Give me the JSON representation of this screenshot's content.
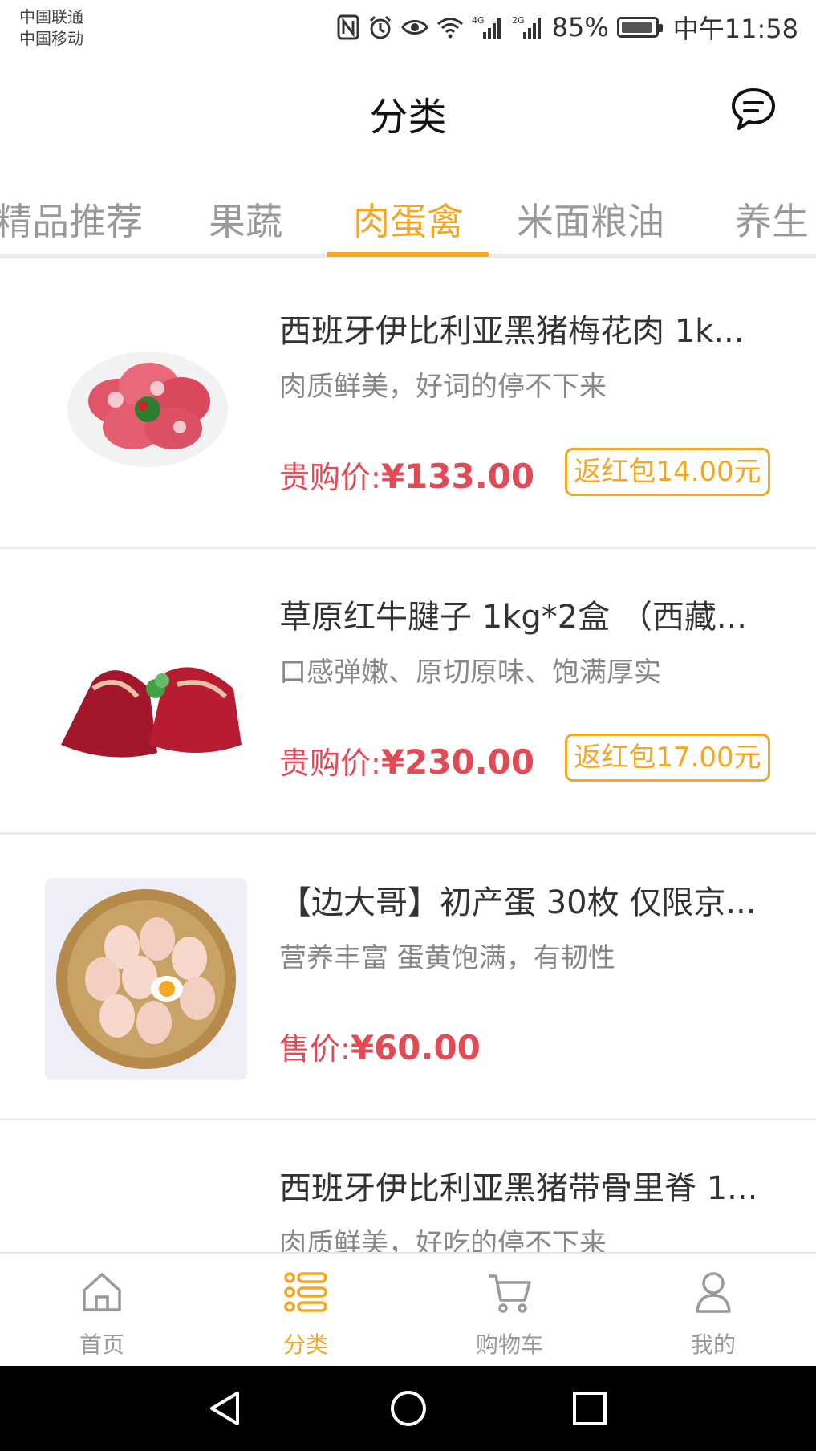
{
  "status_bar": {
    "carrier_1": "中国联通",
    "carrier_2": "中国移动",
    "battery": "85%",
    "time": "中午11:58",
    "icons": [
      "nfc-icon",
      "alarm-icon",
      "eye-icon",
      "wifi-icon",
      "signal-4g-icon",
      "signal-2g-icon",
      "battery-icon"
    ]
  },
  "header": {
    "title": "分类"
  },
  "tabs": [
    {
      "label": "精品推荐",
      "active": false
    },
    {
      "label": "果蔬",
      "active": false
    },
    {
      "label": "肉蛋禽",
      "active": true
    },
    {
      "label": "米面粮油",
      "active": false
    },
    {
      "label": "养生",
      "active": false
    }
  ],
  "products": [
    {
      "title": "西班牙伊比利亚黑猪梅花肉 1k...",
      "desc": "肉质鲜美，好词的停不下来",
      "price_label": "贵购价:",
      "price": "¥133.00",
      "rebate": "返红包14.00元",
      "image": "pork-slices-plate"
    },
    {
      "title": "草原红牛腱子 1kg*2盒 （西藏...",
      "desc": "口感弹嫩、原切原味、饱满厚实",
      "price_label": "贵购价:",
      "price": "¥230.00",
      "rebate": "返红包17.00元",
      "image": "beef-shank"
    },
    {
      "title": "【边大哥】初产蛋 30枚 仅限京...",
      "desc": "营养丰富  蛋黄饱满，有韧性",
      "price_label": "售价:",
      "price": "¥60.00",
      "rebate": "",
      "image": "eggs-basket"
    },
    {
      "title": "西班牙伊比利亚黑猪带骨里脊 1...",
      "desc": "肉质鲜美，好吃的停不下来",
      "price_label": "",
      "price": "",
      "rebate": "",
      "image": "pork-loin"
    }
  ],
  "bottom_nav": [
    {
      "label": "首页",
      "icon": "home-icon",
      "active": false
    },
    {
      "label": "分类",
      "icon": "category-list-icon",
      "active": true
    },
    {
      "label": "购物车",
      "icon": "cart-icon",
      "active": false
    },
    {
      "label": "我的",
      "icon": "profile-icon",
      "active": false
    }
  ],
  "colors": {
    "accent": "#f5a623",
    "price": "#e24a56",
    "muted": "#999999"
  }
}
